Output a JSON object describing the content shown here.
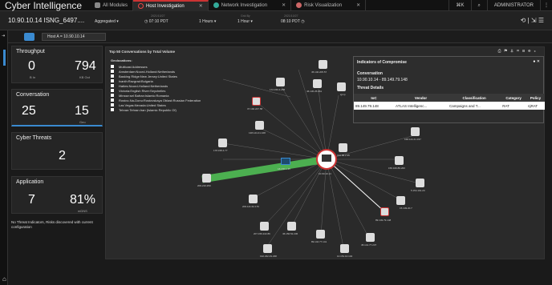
{
  "app": {
    "title": "Cyber Intelligence",
    "tabs": [
      {
        "label": "All Modules",
        "active": false
      },
      {
        "label": "Host Investigation",
        "active": true
      },
      {
        "label": "Network Investigation",
        "active": false
      },
      {
        "label": "Risk Visualization",
        "active": false
      }
    ],
    "kbd_label": "⌘K",
    "search_icon": "search-icon",
    "user": "ADMINISTRATOR"
  },
  "subbar": {
    "host": "10.90.10.14 ISNG_6497....",
    "aggregated": "Aggregated",
    "start_date_label": "2021/10/27",
    "start_time": "07:10 PDT",
    "duration": "1 Hours",
    "grid_label": "Grid By",
    "grid_by": "1 Hour",
    "end_date_label": "2021/10/27",
    "end_time": "08:10 PDT",
    "tools": "⟲ | ⇲ ☰"
  },
  "hostbar": {
    "label": "Host A = 10.90.10.14"
  },
  "cards": {
    "throughput": {
      "title": "Throughput",
      "val1": "0",
      "lbl1": "B In",
      "val2": "794",
      "lbl2": "KB Out"
    },
    "conversation": {
      "title": "Conversation",
      "val1": "25",
      "lbl1": "",
      "val2": "15",
      "lbl2": "Geo"
    },
    "threats": {
      "title": "Cyber Threats",
      "val": "2"
    },
    "application": {
      "title": "Application",
      "val1": "7",
      "val2": "81%",
      "lbl2": "mDNS"
    }
  },
  "no_threat_msg": "No Threat Indicators, Risks discovered with current configuration",
  "graph": {
    "title": "Top 50 Conversations by Total Volume",
    "geo_title": "Geolocations:",
    "geolocations": [
      "Multicast Addresses",
      "Amsterdam:Noord-Holland:Netherlands",
      "Basking Ridge:New Jersey:United States",
      "Ivanih:Razgrad:Bulgaria",
      "Hattes:Noord-Holland:Netherlands",
      "Victoria:English River:Seychelles",
      "Minsse:sel Bafran:Islamic:Romania",
      "Rostov-Na-Donu:Rostovskaya Oblast:Russian Federation",
      "Las Vegas:Nevada:United States",
      "Tehran:Tehran:Iran (Islamic Republic Of)"
    ],
    "center_label": "10.90.10.14",
    "center_ip": "18.200.1.35",
    "nodes": [
      {
        "label": "45.140.205.57"
      },
      {
        "label": "172.150.4.255"
      },
      {
        "label": "46.136.25.861"
      },
      {
        "label": "igmp"
      },
      {
        "label": "37.192.247.58"
      },
      {
        "label": "138.144.41.168"
      },
      {
        "label": "178.158.4.77"
      },
      {
        "label": "194.88.2.35"
      },
      {
        "label": "156.160.89.200"
      },
      {
        "label": "168.144.41.157"
      },
      {
        "label": "5.154.191.20"
      },
      {
        "label": "209.210.253"
      },
      {
        "label": "209.141.62.176"
      },
      {
        "label": "89.149.79.148"
      },
      {
        "label": "15.149.20.7"
      },
      {
        "label": "207.156.222.86"
      },
      {
        "label": "46.156.52.236"
      },
      {
        "label": "89.142.77.141"
      },
      {
        "label": "45.141.77.237"
      },
      {
        "label": "192.232.49.238"
      },
      {
        "label": "10.151.10.104"
      }
    ]
  },
  "ioc": {
    "title": "Indicators of Compromise",
    "conversation_label": "Conversation",
    "conversation": "10.90.10.14  -  89.149.79.148",
    "threat_details": "Threat Details",
    "headers": [
      "IoC",
      "Vendor",
      "Classification",
      "Category",
      "Policy"
    ],
    "row": [
      "89.149.79.148",
      "ATLAS Intelligenc...",
      "Campaigns and T...",
      "RAT",
      "njRAT"
    ]
  }
}
